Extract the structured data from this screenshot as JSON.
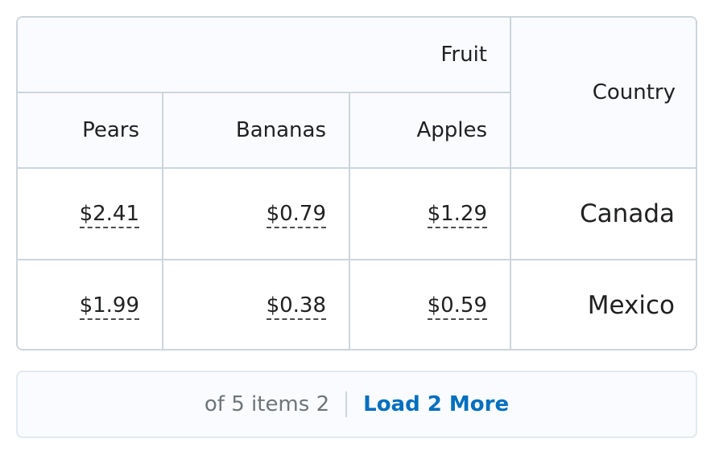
{
  "table": {
    "group_header": "Fruit",
    "country_header": "Country",
    "columns": [
      "Pears",
      "Bananas",
      "Apples"
    ],
    "rows": [
      {
        "prices": [
          "$2.41",
          "$0.79",
          "$1.29"
        ],
        "country": "Canada"
      },
      {
        "prices": [
          "$1.99",
          "$0.38",
          "$0.59"
        ],
        "country": "Mexico"
      }
    ]
  },
  "pager": {
    "count_text": "of 5 items 2",
    "load_more_label": "Load 2 More"
  },
  "colors": {
    "border": "#cdd5dc",
    "header_bg": "#f9fbff",
    "link": "#006fbf",
    "muted_text": "#6e7477"
  }
}
